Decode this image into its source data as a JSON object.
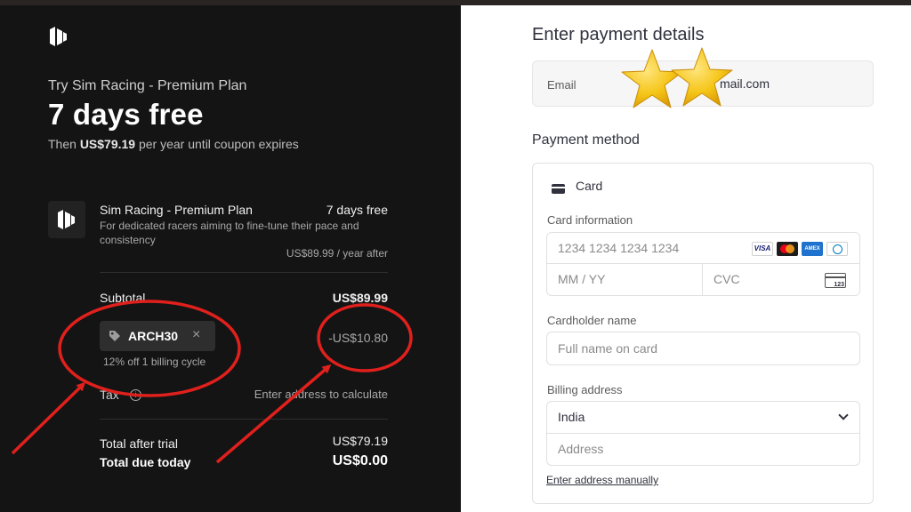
{
  "summary": {
    "try_line": "Try Sim Racing - Premium Plan",
    "free_line": "7 days free",
    "then_prefix": "Then ",
    "then_price": "US$79.19",
    "then_suffix": " per year until coupon expires",
    "product": {
      "name": "Sim Racing - Premium Plan",
      "price": "7 days free",
      "description": "For dedicated racers aiming to fine-tune their pace and consistency",
      "after": "US$89.99 / year after"
    },
    "subtotal_label": "Subtotal",
    "subtotal_value": "US$89.99",
    "coupon": {
      "code": "ARCH30",
      "note": "12% off 1 billing cycle",
      "discount": "-US$10.80"
    },
    "tax_label": "Tax",
    "tax_value": "Enter address to calculate",
    "after_trial_label": "Total after trial",
    "after_trial_value": "US$79.19",
    "due_label": "Total due today",
    "due_value": "US$0.00"
  },
  "payment": {
    "title": "Enter payment details",
    "email_label": "Email",
    "email_value_visible": "mail.com",
    "method_title": "Payment method",
    "card_title": "Card",
    "card_info_label": "Card information",
    "card_number_placeholder": "1234 1234 1234 1234",
    "expiry_placeholder": "MM / YY",
    "cvc_placeholder": "CVC",
    "brands": [
      "VISA",
      "mastercard",
      "AMEX",
      "diners"
    ],
    "cardholder_label": "Cardholder name",
    "cardholder_placeholder": "Full name on card",
    "billing_label": "Billing address",
    "country": "India",
    "address_placeholder": "Address",
    "manual_link": "Enter address manually"
  },
  "colors": {
    "left_bg": "#141414",
    "annotation_red": "#e0201c",
    "star_yellow": "#f5c518"
  }
}
